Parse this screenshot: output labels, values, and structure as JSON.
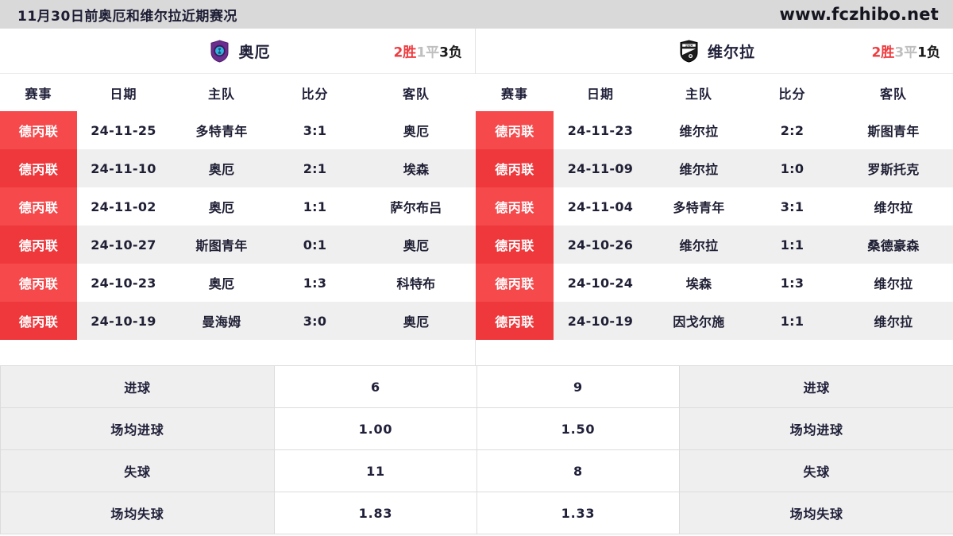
{
  "topbar": {
    "title": "11月30日前奥厄和维尔拉近期赛况",
    "site": "www.fczhibo.net"
  },
  "colors": {
    "accent_red": "#ef3b3f",
    "chip_red_odd": "#f5494c",
    "chip_red_even": "#ee383c",
    "topbar_bg": "#d9d9d9",
    "row_alt_bg": "#efefef"
  },
  "left": {
    "team": {
      "name": "奥厄",
      "logo": "aue-crest-icon",
      "record": {
        "win": "2胜",
        "draw": "1平",
        "loss": "3负"
      }
    },
    "columns": [
      "赛事",
      "日期",
      "主队",
      "比分",
      "客队"
    ],
    "rows": [
      {
        "league": "德丙联",
        "date": "24-11-25",
        "home": "多特青年",
        "score": "3:1",
        "away": "奥厄"
      },
      {
        "league": "德丙联",
        "date": "24-11-10",
        "home": "奥厄",
        "score": "2:1",
        "away": "埃森"
      },
      {
        "league": "德丙联",
        "date": "24-11-02",
        "home": "奥厄",
        "score": "1:1",
        "away": "萨尔布吕"
      },
      {
        "league": "德丙联",
        "date": "24-10-27",
        "home": "斯图青年",
        "score": "0:1",
        "away": "奥厄"
      },
      {
        "league": "德丙联",
        "date": "24-10-23",
        "home": "奥厄",
        "score": "1:3",
        "away": "科特布"
      },
      {
        "league": "德丙联",
        "date": "24-10-19",
        "home": "曼海姆",
        "score": "3:0",
        "away": "奥厄"
      }
    ]
  },
  "right": {
    "team": {
      "name": "维尔拉",
      "logo": "verl-crest-icon",
      "record": {
        "win": "2胜",
        "draw": "3平",
        "loss": "1负"
      }
    },
    "columns": [
      "赛事",
      "日期",
      "主队",
      "比分",
      "客队"
    ],
    "rows": [
      {
        "league": "德丙联",
        "date": "24-11-23",
        "home": "维尔拉",
        "score": "2:2",
        "away": "斯图青年"
      },
      {
        "league": "德丙联",
        "date": "24-11-09",
        "home": "维尔拉",
        "score": "1:0",
        "away": "罗斯托克"
      },
      {
        "league": "德丙联",
        "date": "24-11-04",
        "home": "多特青年",
        "score": "3:1",
        "away": "维尔拉"
      },
      {
        "league": "德丙联",
        "date": "24-10-26",
        "home": "维尔拉",
        "score": "1:1",
        "away": "桑德豪森"
      },
      {
        "league": "德丙联",
        "date": "24-10-24",
        "home": "埃森",
        "score": "1:3",
        "away": "维尔拉"
      },
      {
        "league": "德丙联",
        "date": "24-10-19",
        "home": "因戈尔施",
        "score": "1:1",
        "away": "维尔拉"
      }
    ]
  },
  "stats": [
    {
      "label_left": "进球",
      "value_left": "6",
      "value_right": "9",
      "label_right": "进球"
    },
    {
      "label_left": "场均进球",
      "value_left": "1.00",
      "value_right": "1.50",
      "label_right": "场均进球"
    },
    {
      "label_left": "失球",
      "value_left": "11",
      "value_right": "8",
      "label_right": "失球"
    },
    {
      "label_left": "场均失球",
      "value_left": "1.83",
      "value_right": "1.33",
      "label_right": "场均失球"
    }
  ]
}
